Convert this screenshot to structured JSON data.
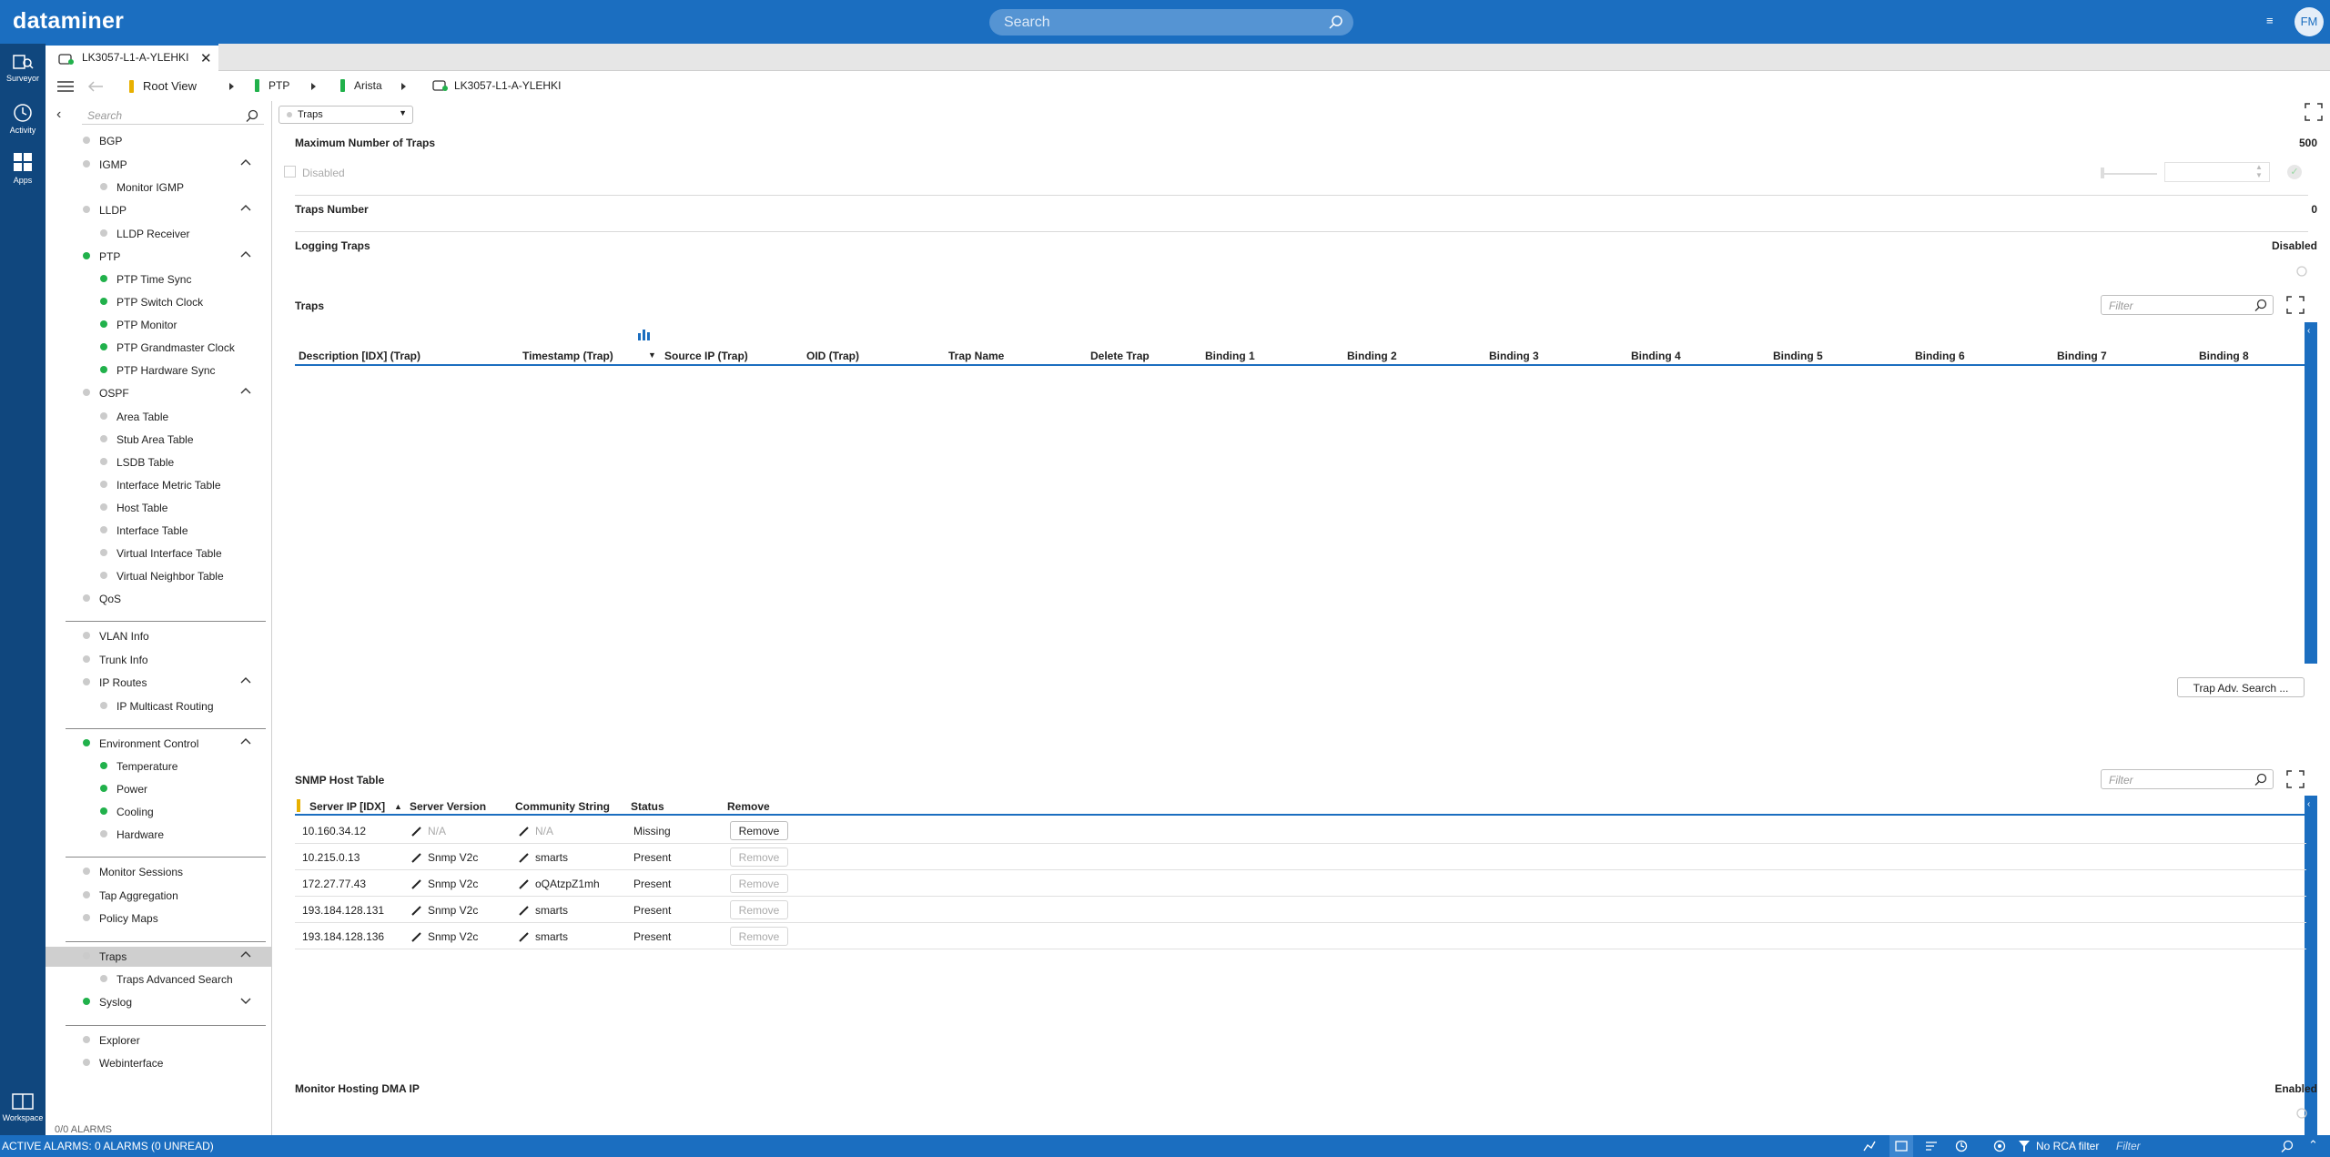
{
  "app": {
    "logo": "dataminer",
    "search_placeholder": "Search",
    "avatar": "FM"
  },
  "leftnav": [
    {
      "label": "Surveyor",
      "icon": "surveyor-icon"
    },
    {
      "label": "Activity",
      "icon": "activity-icon"
    },
    {
      "label": "Apps",
      "icon": "apps-icon"
    },
    {
      "label": "Workspace",
      "icon": "workspace-icon"
    }
  ],
  "tab": {
    "title": "LK3057-L1-A-YLEHKI"
  },
  "breadcrumb": {
    "root": "Root View",
    "items": [
      "PTP",
      "Arista",
      "LK3057-L1-A-YLEHKI"
    ]
  },
  "sidebar": {
    "search_placeholder": "Search",
    "items": [
      {
        "label": "BGP",
        "level": 0,
        "status": "grey"
      },
      {
        "label": "IGMP",
        "level": 0,
        "status": "grey",
        "chevron": "up"
      },
      {
        "label": "Monitor IGMP",
        "level": 1,
        "status": "grey"
      },
      {
        "label": "LLDP",
        "level": 0,
        "status": "grey",
        "chevron": "up"
      },
      {
        "label": "LLDP Receiver",
        "level": 1,
        "status": "grey"
      },
      {
        "label": "PTP",
        "level": 0,
        "status": "green",
        "chevron": "up"
      },
      {
        "label": "PTP Time Sync",
        "level": 1,
        "status": "green"
      },
      {
        "label": "PTP Switch Clock",
        "level": 1,
        "status": "green"
      },
      {
        "label": "PTP Monitor",
        "level": 1,
        "status": "green"
      },
      {
        "label": "PTP Grandmaster Clock",
        "level": 1,
        "status": "green"
      },
      {
        "label": "PTP Hardware Sync",
        "level": 1,
        "status": "green"
      },
      {
        "label": "OSPF",
        "level": 0,
        "status": "grey",
        "chevron": "up"
      },
      {
        "label": "Area Table",
        "level": 1,
        "status": "grey"
      },
      {
        "label": "Stub Area Table",
        "level": 1,
        "status": "grey"
      },
      {
        "label": "LSDB Table",
        "level": 1,
        "status": "grey"
      },
      {
        "label": "Interface Metric Table",
        "level": 1,
        "status": "grey"
      },
      {
        "label": "Host Table",
        "level": 1,
        "status": "grey"
      },
      {
        "label": "Interface Table",
        "level": 1,
        "status": "grey"
      },
      {
        "label": "Virtual Interface Table",
        "level": 1,
        "status": "grey"
      },
      {
        "label": "Virtual Neighbor Table",
        "level": 1,
        "status": "grey"
      },
      {
        "label": "QoS",
        "level": 0,
        "status": "grey"
      },
      {
        "sep": true
      },
      {
        "label": "VLAN Info",
        "level": 0,
        "status": "grey"
      },
      {
        "label": "Trunk Info",
        "level": 0,
        "status": "grey"
      },
      {
        "label": "IP Routes",
        "level": 0,
        "status": "grey",
        "chevron": "up"
      },
      {
        "label": "IP Multicast Routing",
        "level": 1,
        "status": "grey"
      },
      {
        "sep": true
      },
      {
        "label": "Environment Control",
        "level": 0,
        "status": "green",
        "chevron": "up"
      },
      {
        "label": "Temperature",
        "level": 1,
        "status": "green"
      },
      {
        "label": "Power",
        "level": 1,
        "status": "green"
      },
      {
        "label": "Cooling",
        "level": 1,
        "status": "green"
      },
      {
        "label": "Hardware",
        "level": 1,
        "status": "grey"
      },
      {
        "sep": true
      },
      {
        "label": "Monitor Sessions",
        "level": 0,
        "status": "grey"
      },
      {
        "label": "Tap Aggregation",
        "level": 0,
        "status": "grey"
      },
      {
        "label": "Policy Maps",
        "level": 0,
        "status": "grey"
      },
      {
        "sep": true
      },
      {
        "label": "Traps",
        "level": 0,
        "status": "grey",
        "chevron": "up",
        "selected": true
      },
      {
        "label": "Traps Advanced Search",
        "level": 1,
        "status": "grey"
      },
      {
        "label": "Syslog",
        "level": 0,
        "status": "green",
        "chevron": "down"
      },
      {
        "sep": true
      },
      {
        "label": "Explorer",
        "level": 0,
        "status": "grey"
      },
      {
        "label": "Webinterface",
        "level": 0,
        "status": "grey"
      }
    ],
    "footer": "0/0 ALARMS"
  },
  "main": {
    "page_select": "Traps",
    "max_traps": {
      "label": "Maximum Number of Traps",
      "value": "500",
      "checkbox_label": "Disabled"
    },
    "traps_number": {
      "label": "Traps Number",
      "value": "0"
    },
    "logging_traps": {
      "label": "Logging Traps",
      "value": "Disabled"
    },
    "traps_table": {
      "title": "Traps",
      "filter_placeholder": "Filter",
      "columns": [
        "Description [IDX] (Trap)",
        "Timestamp (Trap)",
        "Source IP (Trap)",
        "OID (Trap)",
        "Trap Name",
        "Delete Trap",
        "Binding 1",
        "Binding 2",
        "Binding 3",
        "Binding 4",
        "Binding 5",
        "Binding 6",
        "Binding 7",
        "Binding 8"
      ],
      "adv_search_button": "Trap Adv. Search ..."
    },
    "snmp_table": {
      "title": "SNMP Host Table",
      "filter_placeholder": "Filter",
      "columns": [
        "Server IP [IDX]",
        "Server Version",
        "Community String",
        "Status",
        "Remove"
      ],
      "rows": [
        {
          "ip": "10.160.34.12",
          "version": "N/A",
          "community": "N/A",
          "status": "Missing",
          "remove": "Remove"
        },
        {
          "ip": "10.215.0.13",
          "version": "Snmp V2c",
          "community": "smarts",
          "status": "Present",
          "remove": "Remove"
        },
        {
          "ip": "172.27.77.43",
          "version": "Snmp V2c",
          "community": "oQAtzpZ1mh",
          "status": "Present",
          "remove": "Remove"
        },
        {
          "ip": "193.184.128.131",
          "version": "Snmp V2c",
          "community": "smarts",
          "status": "Present",
          "remove": "Remove"
        },
        {
          "ip": "193.184.128.136",
          "version": "Snmp V2c",
          "community": "smarts",
          "status": "Present",
          "remove": "Remove"
        }
      ]
    },
    "monitor_hosting": {
      "label": "Monitor Hosting DMA IP",
      "value": "Enabled"
    }
  },
  "statusbar": {
    "alarms": "ACTIVE ALARMS: 0 ALARMS (0 UNREAD)",
    "rca": "No RCA filter",
    "filter_placeholder": "Filter"
  },
  "colors": {
    "brand": "#1b6ec0",
    "nav": "#10477e",
    "ok": "#21b14b"
  }
}
